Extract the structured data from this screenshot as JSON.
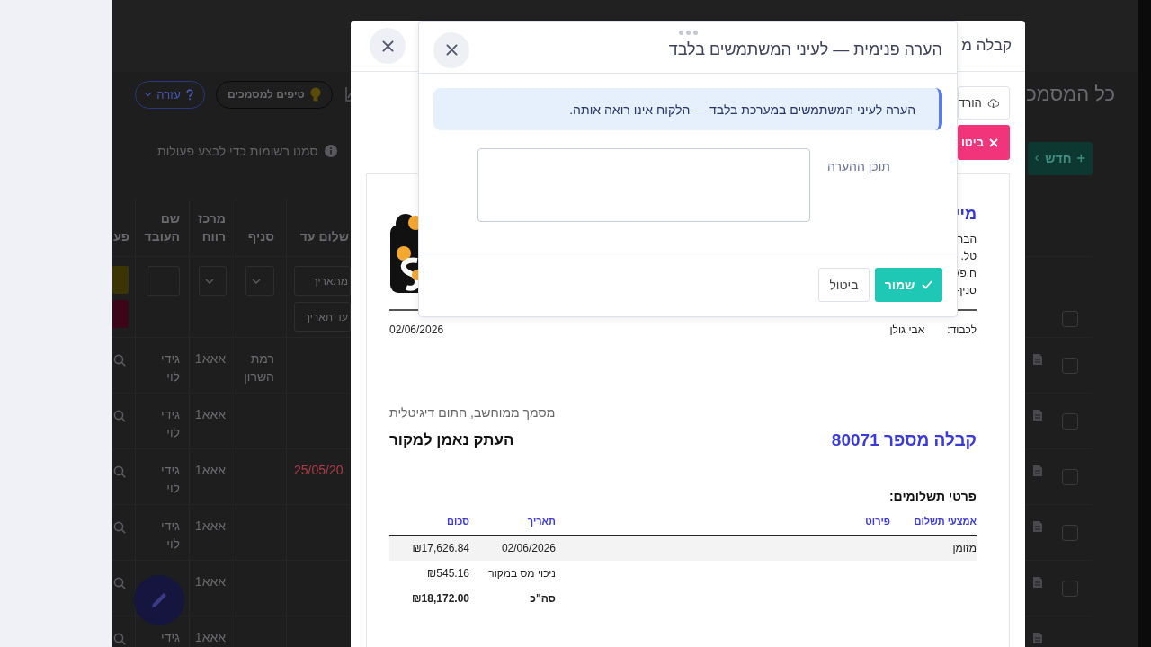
{
  "page": {
    "title": "כל המסמכ",
    "toolbar_buttons": [
      {
        "kind": "tips",
        "label": "טיפים למסמכים"
      },
      {
        "kind": "help",
        "label": "עזרה"
      }
    ],
    "new_button": {
      "label": "חדש"
    },
    "selection_hint": "סמנו רשומות כדי לבצע פעולות",
    "table": {
      "all_selected": false,
      "columns": [
        {
          "label": "שלום עד",
          "kind": "date_range",
          "placeholders": [
            "מתאריך",
            "עד תאריך"
          ]
        },
        {
          "label": "סניף",
          "kind": "select"
        },
        {
          "label": "מרכז רווח",
          "kind": "select"
        },
        {
          "label": "שם העובד",
          "kind": "text"
        },
        {
          "label": "פע",
          "kind": "actions"
        }
      ],
      "rows": [
        {
          "selected": false,
          "branch": "רמת השרון",
          "profit_center": "אאא1",
          "employee": "גידי לוי"
        },
        {
          "selected": false,
          "profit_center": "אאא1",
          "employee": "גידי לוי"
        },
        {
          "selected": false,
          "due_date": "25/05/20",
          "overdue": true,
          "profit_center": "אאא1",
          "employee": "גידי לוי"
        },
        {
          "selected": false,
          "profit_center": "אאא1",
          "employee": "גידי לוי"
        },
        {
          "selected": false,
          "profit_center": "אאא1"
        },
        {
          "profit_center": "אאא1",
          "employee": "גידי"
        }
      ]
    }
  },
  "receipt_modal": {
    "title": "קבלה מ",
    "actions": [
      {
        "kind": "download",
        "label": "הורד"
      },
      {
        "kind": "cancel",
        "label": "ביטו"
      }
    ],
    "document": {
      "company_name": "מיי",
      "company_lines": [
        "הבר",
        "טל.",
        "ח.פ/",
        "סניף"
      ],
      "recipient_label": "לכבוד:",
      "recipient": "אבי גולן",
      "date": "02/06/2026",
      "signature_note": "מסמך ממוחשב, חתום דיגיטלית",
      "title": "קבלה מספר 80071",
      "copy_note": "העתק נאמן למקור",
      "payments_title": "פרטי תשלומים:",
      "payments": {
        "columns": [
          "אמצעי תשלום",
          "פירוט",
          "תאריך",
          "סכום"
        ],
        "rows": [
          {
            "kind": "payment",
            "method": "מזומן",
            "date": "02/06/2026",
            "amount": "₪17,626.84"
          },
          {
            "kind": "deduction",
            "label": "ניכוי מס במקור",
            "amount": "₪545.16"
          },
          {
            "kind": "total",
            "label": "סה\"כ",
            "amount": "₪18,172.00"
          }
        ]
      }
    }
  },
  "note_dialog": {
    "title": "הערה פנימית — לעיני המשתמשים בלבד",
    "notice": "הערה לעיני המשתמשים במערכת בלבד — הלקוח אינו רואה אותה.",
    "field_label": "תוכן ההערה",
    "buttons": [
      {
        "kind": "save",
        "label": "שמור"
      },
      {
        "kind": "cancel",
        "label": "ביטול"
      }
    ]
  }
}
